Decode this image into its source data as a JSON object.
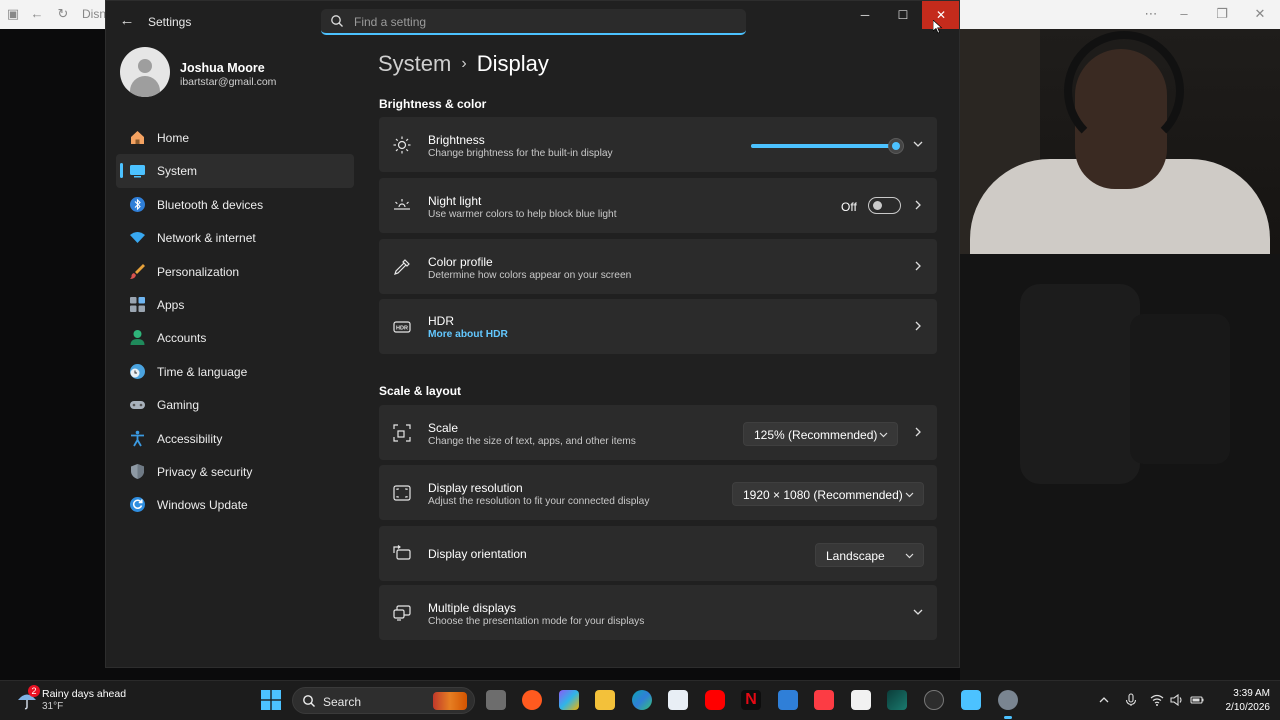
{
  "background": {
    "browser_title": "Disn"
  },
  "settings": {
    "app_title": "Settings",
    "search_placeholder": "Find a setting",
    "profile": {
      "name": "Joshua Moore",
      "email": "ibartstar@gmail.com"
    },
    "nav": [
      {
        "label": "Home",
        "icon": "home-icon",
        "active": false
      },
      {
        "label": "System",
        "icon": "system-icon",
        "active": true
      },
      {
        "label": "Bluetooth & devices",
        "icon": "bluetooth-icon",
        "active": false
      },
      {
        "label": "Network & internet",
        "icon": "wifi-icon",
        "active": false
      },
      {
        "label": "Personalization",
        "icon": "brush-icon",
        "active": false
      },
      {
        "label": "Apps",
        "icon": "apps-icon",
        "active": false
      },
      {
        "label": "Accounts",
        "icon": "accounts-icon",
        "active": false
      },
      {
        "label": "Time & language",
        "icon": "globe-clock-icon",
        "active": false
      },
      {
        "label": "Gaming",
        "icon": "gamepad-icon",
        "active": false
      },
      {
        "label": "Accessibility",
        "icon": "accessibility-icon",
        "active": false
      },
      {
        "label": "Privacy & security",
        "icon": "shield-icon",
        "active": false
      },
      {
        "label": "Windows Update",
        "icon": "update-icon",
        "active": false
      }
    ],
    "breadcrumb": {
      "parent": "System",
      "current": "Display"
    },
    "sections": {
      "brightness_color": "Brightness & color",
      "scale_layout": "Scale & layout"
    },
    "brightness": {
      "title": "Brightness",
      "subtitle": "Change brightness for the built-in display",
      "level": 1.0
    },
    "night_light": {
      "title": "Night light",
      "subtitle": "Use warmer colors to help block blue light",
      "state": "Off"
    },
    "color_profile": {
      "title": "Color profile",
      "subtitle": "Determine how colors appear on your screen"
    },
    "hdr": {
      "title": "HDR",
      "link": "More about HDR"
    },
    "scale": {
      "title": "Scale",
      "subtitle": "Change the size of text, apps, and other items",
      "value": "125% (Recommended)"
    },
    "resolution": {
      "title": "Display resolution",
      "subtitle": "Adjust the resolution to fit your connected display",
      "value": "1920 × 1080 (Recommended)"
    },
    "orientation": {
      "title": "Display orientation",
      "value": "Landscape"
    },
    "multiple_displays": {
      "title": "Multiple displays",
      "subtitle": "Choose the presentation mode for your displays"
    }
  },
  "taskbar": {
    "weather_title": "Rainy days ahead",
    "weather_temp": "31°F",
    "weather_badge": "2",
    "search_label": "Search",
    "time": "3:39 AM",
    "date": "2/10/2026"
  },
  "colors": {
    "accent": "#4cc2ff",
    "close_red": "#c42b1c",
    "card_bg": "#2b2b2b",
    "window_bg": "#202020"
  }
}
